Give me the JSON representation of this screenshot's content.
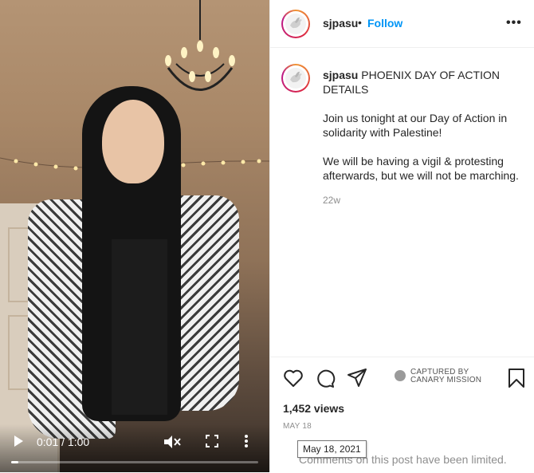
{
  "video": {
    "time": "0:01 / 1:00",
    "progress": 0.03
  },
  "header": {
    "username": "sjpasu",
    "dot": "•",
    "follow_label": "Follow",
    "options": "•••"
  },
  "caption": {
    "username": "sjpasu",
    "title": "PHOENIX DAY OF ACTION DETAILS",
    "para1": "Join us tonight at our Day of Action in solidarity with Palestine!",
    "para2": "We will be having a vigil & protesting afterwards, but we will not be marching.",
    "age": "22w"
  },
  "actions": {
    "watermark_line1": "CAPTURED BY",
    "watermark_line2": "CANARY MISSION",
    "views": "1,452 views",
    "date": "MAY 18",
    "tooltip": "May 18, 2021",
    "comments_limited": "Comments on this post have been limited."
  },
  "colors": {
    "accent": "#0095f6",
    "text": "#262626",
    "muted": "#8e8e8e"
  },
  "icons": [
    "play-icon",
    "mute-icon",
    "fullscreen-icon",
    "more-vertical-icon",
    "heart-icon",
    "comment-icon",
    "share-icon",
    "bookmark-icon",
    "dove-icon",
    "canary-logo-icon"
  ]
}
